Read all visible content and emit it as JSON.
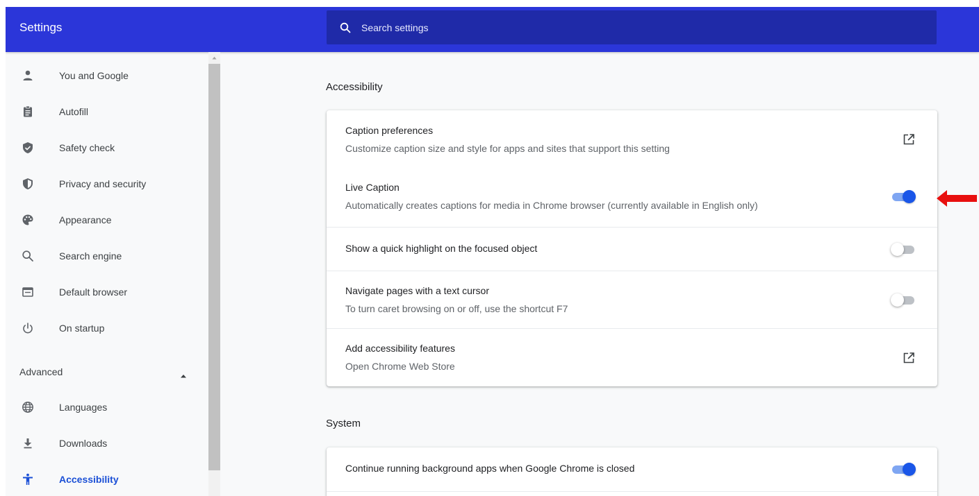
{
  "header": {
    "title": "Settings",
    "search_placeholder": "Search settings"
  },
  "sidebar": {
    "items": [
      {
        "label": "You and Google",
        "icon": "person-icon"
      },
      {
        "label": "Autofill",
        "icon": "clipboard-icon"
      },
      {
        "label": "Safety check",
        "icon": "shield-check-icon"
      },
      {
        "label": "Privacy and security",
        "icon": "shield-icon"
      },
      {
        "label": "Appearance",
        "icon": "palette-icon"
      },
      {
        "label": "Search engine",
        "icon": "search-icon"
      },
      {
        "label": "Default browser",
        "icon": "browser-icon"
      },
      {
        "label": "On startup",
        "icon": "power-icon"
      }
    ],
    "advanced_label": "Advanced",
    "advanced_items": [
      {
        "label": "Languages",
        "icon": "globe-icon"
      },
      {
        "label": "Downloads",
        "icon": "download-icon"
      },
      {
        "label": "Accessibility",
        "icon": "accessibility-icon",
        "active": true
      }
    ]
  },
  "main": {
    "accessibility": {
      "title": "Accessibility",
      "rows": [
        {
          "title": "Caption preferences",
          "subtitle": "Customize caption size and style for apps and sites that support this setting",
          "control": "external-link"
        },
        {
          "title": "Live Caption",
          "subtitle": "Automatically creates captions for media in Chrome browser (currently available in English only)",
          "control": "toggle",
          "on": true
        },
        {
          "title": "Show a quick highlight on the focused object",
          "control": "toggle",
          "on": false
        },
        {
          "title": "Navigate pages with a text cursor",
          "subtitle": "To turn caret browsing on or off, use the shortcut F7",
          "control": "toggle",
          "on": false
        },
        {
          "title": "Add accessibility features",
          "subtitle": "Open Chrome Web Store",
          "control": "external-link"
        }
      ]
    },
    "system": {
      "title": "System",
      "rows": [
        {
          "title": "Continue running background apps when Google Chrome is closed",
          "control": "toggle",
          "on": true
        }
      ]
    }
  },
  "colors": {
    "header": "#2b36d9",
    "search_box": "#1f2aa8",
    "accent": "#1a56e8",
    "annotation_arrow": "#e8100f"
  }
}
